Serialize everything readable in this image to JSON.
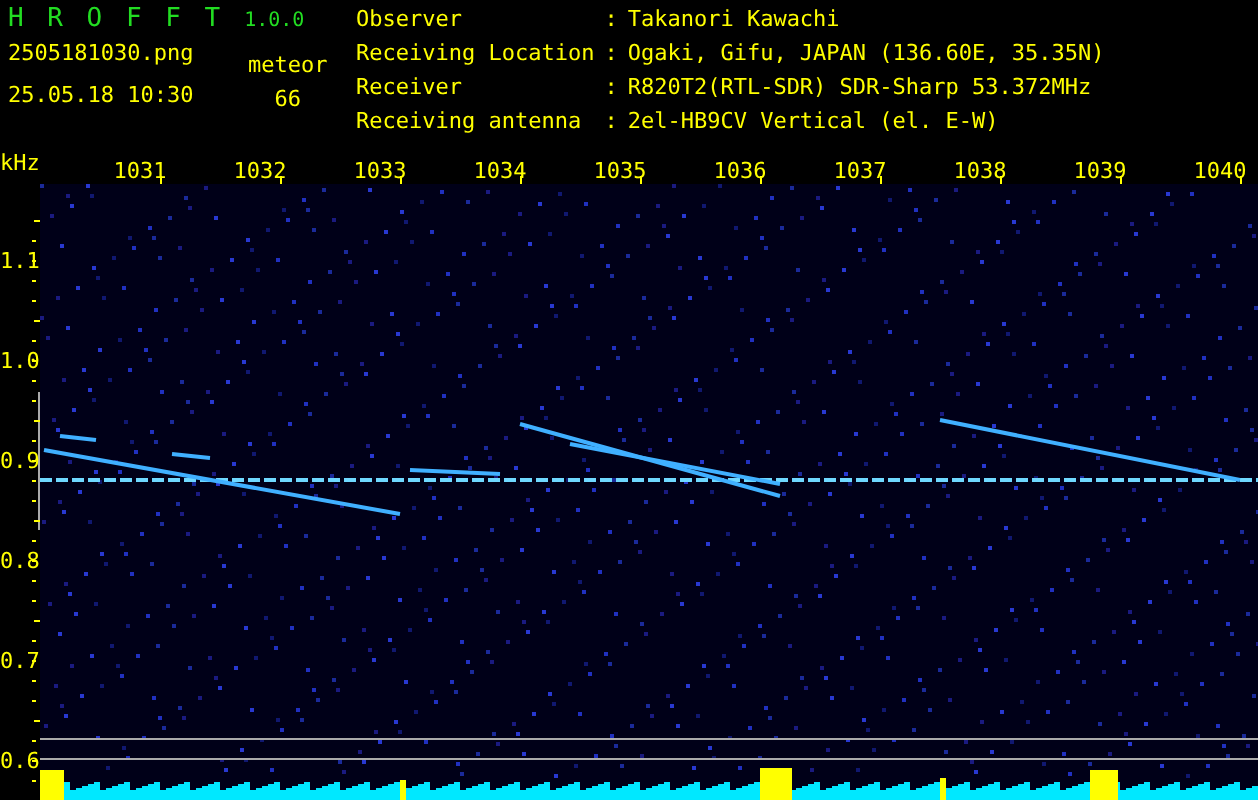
{
  "app": {
    "name": "H R O F F T",
    "version": "1.0.0"
  },
  "file": "2505181030.png",
  "datetime": "25.05.18 10:30",
  "meteor": {
    "label": "meteor",
    "count": "66"
  },
  "info": [
    {
      "label": "Observer",
      "separator": ":",
      "value": "Takanori Kawachi"
    },
    {
      "label": "Receiving Location",
      "separator": ":",
      "value": "Ogaki, Gifu, JAPAN (136.60E, 35.35N)"
    },
    {
      "label": "Receiver",
      "separator": ":",
      "value": "R820T2(RTL-SDR) SDR-Sharp 53.372MHz"
    },
    {
      "label": "Receiving antenna",
      "separator": ":",
      "value": "2el-HB9CV Vertical (el. E-W)"
    }
  ],
  "spectrogram": {
    "y_unit": "kHz",
    "x_labels": [
      "1031",
      "1032",
      "1033",
      "1034",
      "1035",
      "1036",
      "1037",
      "1038",
      "1039",
      "1040"
    ],
    "y_labels": [
      "1.1",
      "1.0",
      "0.9",
      "0.8",
      "0.7",
      "0.6"
    ]
  }
}
